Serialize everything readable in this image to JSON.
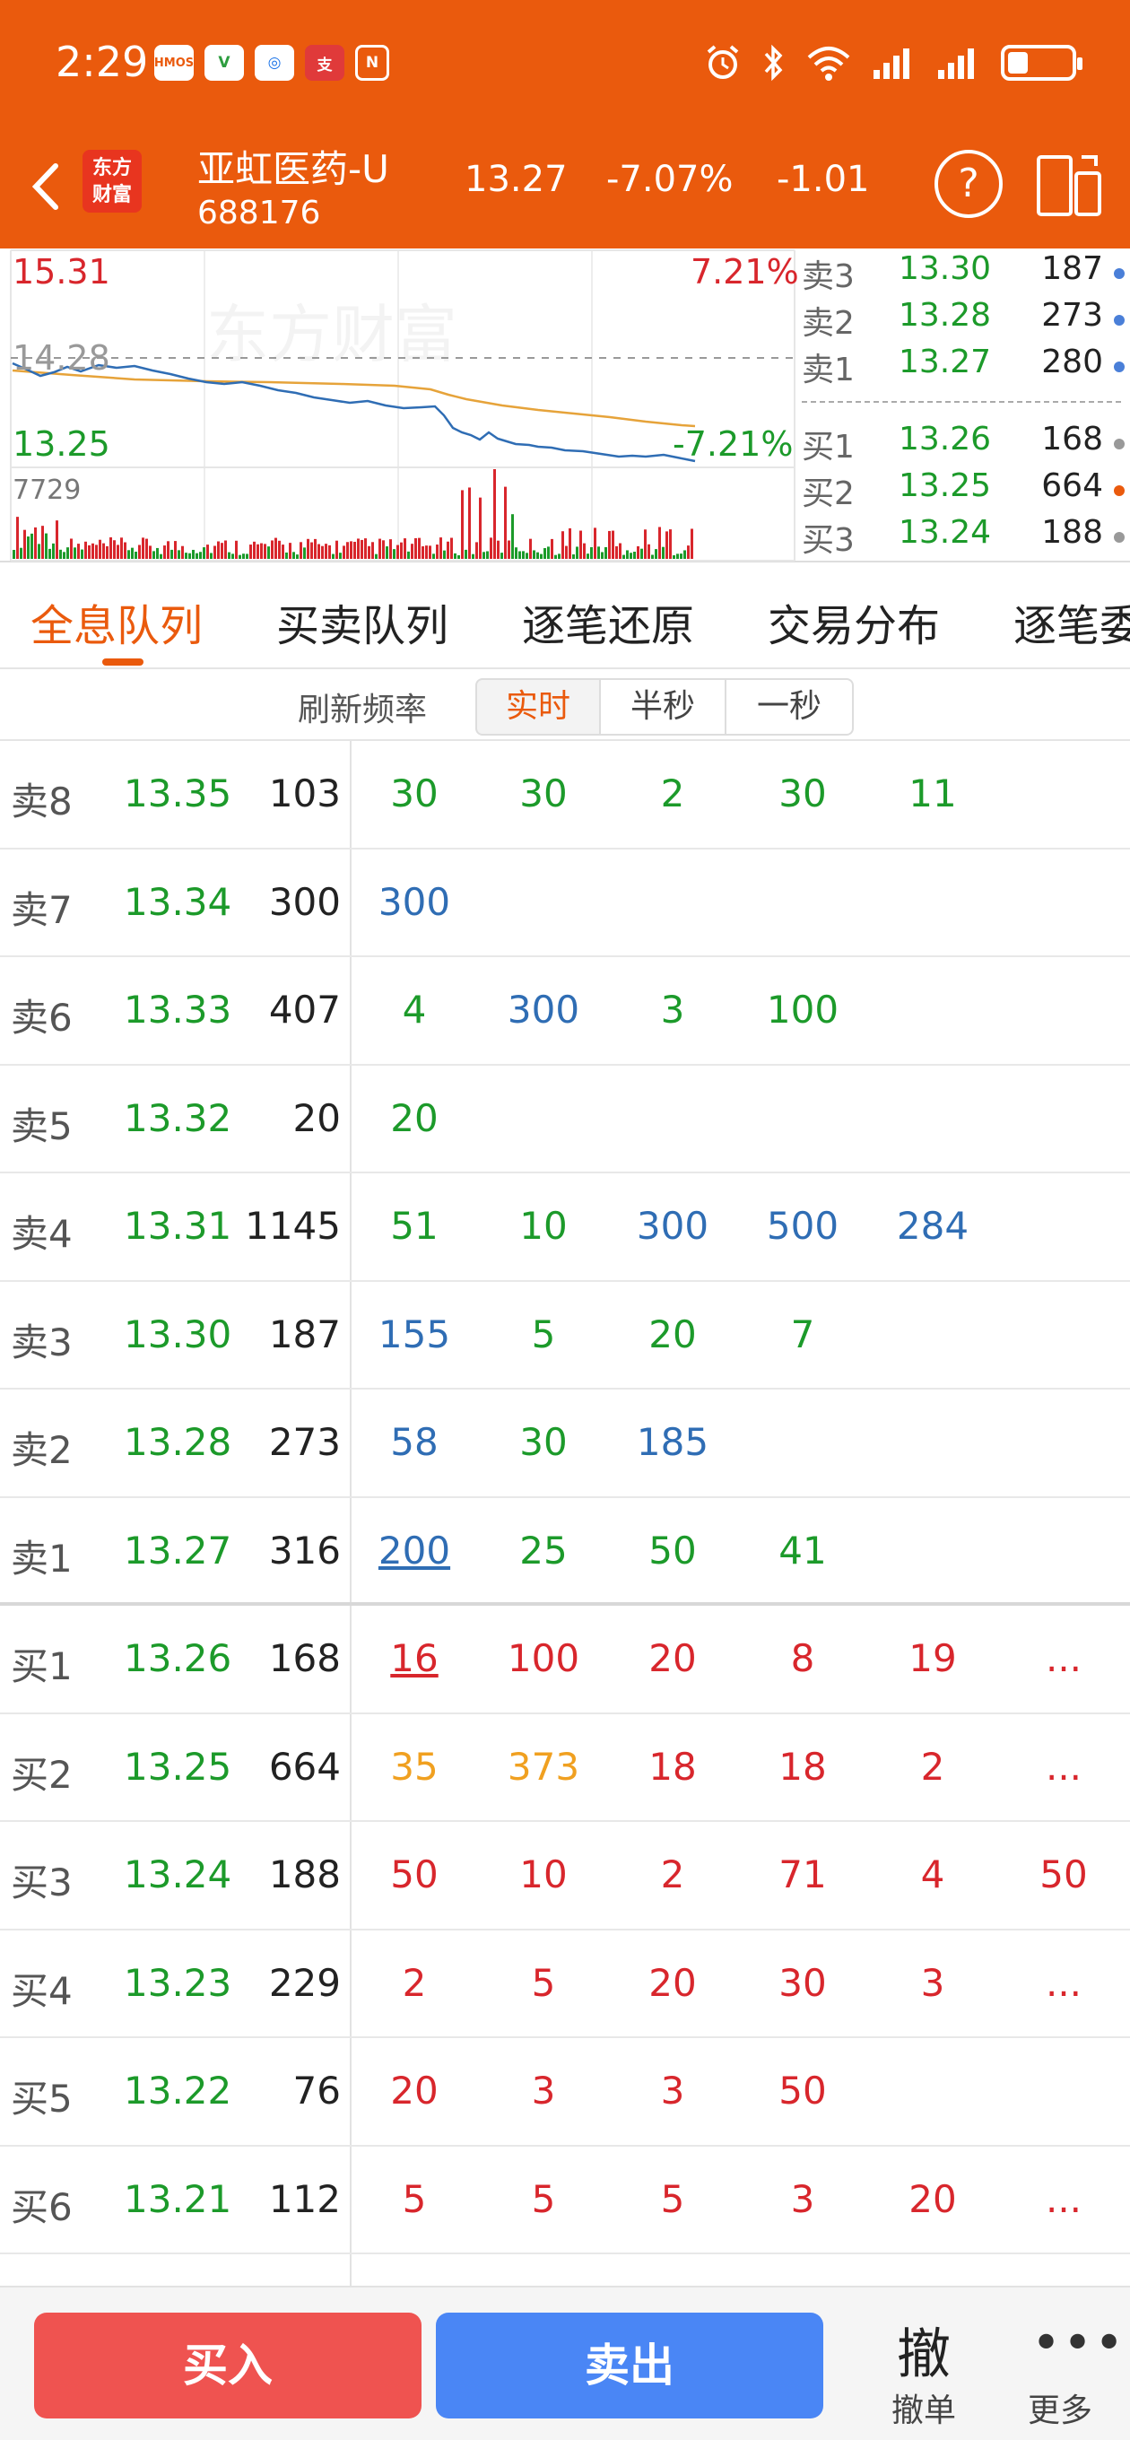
{
  "status_bar": {
    "time": "2:29",
    "left_icons": [
      "HMOS",
      "V",
      "◎",
      "支",
      "N"
    ]
  },
  "header": {
    "logo": "东方财富",
    "stock_name": "亚虹医药-U",
    "stock_code": "688176",
    "price": "13.27",
    "change_pct": "-7.07%",
    "change": "-1.01",
    "help": "?"
  },
  "chart": {
    "high_price": "15.31",
    "high_pct": "7.21%",
    "ref_price": "14.28",
    "low_price": "13.25",
    "low_pct": "-7.21%",
    "volume_max": "7729",
    "watermark": "东方财富",
    "colors": {
      "price_line": "#2f6db4",
      "avg_line": "#e6a33a",
      "up": "#d8262c",
      "down": "#1c9a2a"
    },
    "order_book": [
      {
        "label": "卖3",
        "price": "13.30",
        "volume": "187",
        "dot": "#4a7fd8"
      },
      {
        "label": "卖2",
        "price": "13.28",
        "volume": "273",
        "dot": "#4a7fd8"
      },
      {
        "label": "卖1",
        "price": "13.27",
        "volume": "280",
        "dot": "#4a7fd8"
      },
      {
        "label": "买1",
        "price": "13.26",
        "volume": "168",
        "dot": "#999999"
      },
      {
        "label": "买2",
        "price": "13.25",
        "volume": "664",
        "dot": "#ea5a0d"
      },
      {
        "label": "买3",
        "price": "13.24",
        "volume": "188",
        "dot": "#999999"
      }
    ]
  },
  "tabs": [
    "全息队列",
    "买卖队列",
    "逐笔还原",
    "交易分布",
    "逐笔委"
  ],
  "refresh": {
    "label": "刷新频率",
    "options": [
      "实时",
      "半秒",
      "一秒"
    ],
    "selected": "实时"
  },
  "queue": [
    {
      "label": "卖8",
      "price": "13.35",
      "volume": "103",
      "orders": [
        [
          "30",
          "green"
        ],
        [
          "30",
          "green"
        ],
        [
          "2",
          "green"
        ],
        [
          "30",
          "green"
        ],
        [
          "11",
          "green"
        ]
      ]
    },
    {
      "label": "卖7",
      "price": "13.34",
      "volume": "300",
      "orders": [
        [
          "300",
          "blue"
        ]
      ]
    },
    {
      "label": "卖6",
      "price": "13.33",
      "volume": "407",
      "orders": [
        [
          "4",
          "green"
        ],
        [
          "300",
          "blue"
        ],
        [
          "3",
          "green"
        ],
        [
          "100",
          "green"
        ]
      ]
    },
    {
      "label": "卖5",
      "price": "13.32",
      "volume": "20",
      "orders": [
        [
          "20",
          "green"
        ]
      ]
    },
    {
      "label": "卖4",
      "price": "13.31",
      "volume": "1145",
      "orders": [
        [
          "51",
          "green"
        ],
        [
          "10",
          "green"
        ],
        [
          "300",
          "blue"
        ],
        [
          "500",
          "blue"
        ],
        [
          "284",
          "blue"
        ]
      ]
    },
    {
      "label": "卖3",
      "price": "13.30",
      "volume": "187",
      "orders": [
        [
          "155",
          "blue"
        ],
        [
          "5",
          "green"
        ],
        [
          "20",
          "green"
        ],
        [
          "7",
          "green"
        ]
      ]
    },
    {
      "label": "卖2",
      "price": "13.28",
      "volume": "273",
      "orders": [
        [
          "58",
          "blue"
        ],
        [
          "30",
          "green"
        ],
        [
          "185",
          "blue"
        ]
      ]
    },
    {
      "label": "卖1",
      "price": "13.27",
      "volume": "316",
      "orders": [
        [
          "200",
          "blue-ul"
        ],
        [
          "25",
          "green"
        ],
        [
          "50",
          "green"
        ],
        [
          "41",
          "green"
        ]
      ]
    },
    {
      "label": "买1",
      "price": "13.26",
      "volume": "168",
      "orders": [
        [
          "16",
          "red-ul"
        ],
        [
          "100",
          "red"
        ],
        [
          "20",
          "red"
        ],
        [
          "8",
          "red"
        ],
        [
          "19",
          "red"
        ],
        [
          "...",
          "red"
        ]
      ]
    },
    {
      "label": "买2",
      "price": "13.25",
      "volume": "664",
      "orders": [
        [
          "35",
          "orange"
        ],
        [
          "373",
          "orange"
        ],
        [
          "18",
          "red"
        ],
        [
          "18",
          "red"
        ],
        [
          "2",
          "red"
        ],
        [
          "...",
          "red"
        ]
      ]
    },
    {
      "label": "买3",
      "price": "13.24",
      "volume": "188",
      "orders": [
        [
          "50",
          "red"
        ],
        [
          "10",
          "red"
        ],
        [
          "2",
          "red"
        ],
        [
          "71",
          "red"
        ],
        [
          "4",
          "red"
        ],
        [
          "50",
          "red"
        ]
      ]
    },
    {
      "label": "买4",
      "price": "13.23",
      "volume": "229",
      "orders": [
        [
          "2",
          "red"
        ],
        [
          "5",
          "red"
        ],
        [
          "20",
          "red"
        ],
        [
          "30",
          "red"
        ],
        [
          "3",
          "red"
        ],
        [
          "...",
          "red"
        ]
      ]
    },
    {
      "label": "买5",
      "price": "13.22",
      "volume": "76",
      "orders": [
        [
          "20",
          "red"
        ],
        [
          "3",
          "red"
        ],
        [
          "3",
          "red"
        ],
        [
          "50",
          "red"
        ]
      ]
    },
    {
      "label": "买6",
      "price": "13.21",
      "volume": "112",
      "orders": [
        [
          "5",
          "red"
        ],
        [
          "5",
          "red"
        ],
        [
          "5",
          "red"
        ],
        [
          "3",
          "red"
        ],
        [
          "20",
          "red"
        ],
        [
          "...",
          "red"
        ]
      ]
    }
  ],
  "bottom": {
    "buy": "买入",
    "sell": "卖出",
    "cancel_icon": "撤",
    "cancel": "撤单",
    "more": "更多"
  }
}
